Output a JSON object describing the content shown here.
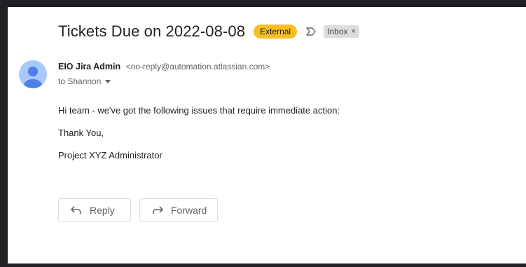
{
  "email": {
    "subject": "Tickets Due on 2022-08-08",
    "labels": {
      "external": "External",
      "inbox": "Inbox",
      "inbox_remove": "×"
    },
    "sender": {
      "name": "EIO Jira Admin",
      "email": "<no-reply@automation.atlassian.com>",
      "to": "to Shannon"
    },
    "body": {
      "p1": "Hi team - we've got the following issues that require immediate action:",
      "p2": "Thank You,",
      "p3": "Project XYZ Administrator"
    }
  },
  "actions": {
    "reply_label": "Reply",
    "forward_label": "Forward"
  },
  "colors": {
    "external_badge": "#f6bf26",
    "avatar_bg": "#a8c7fa",
    "avatar_fg": "#4b80e6"
  },
  "icons": [
    "important-marker-icon",
    "person-avatar-icon",
    "reply-arrow-icon",
    "forward-arrow-icon",
    "chevron-down-icon",
    "close-icon"
  ]
}
